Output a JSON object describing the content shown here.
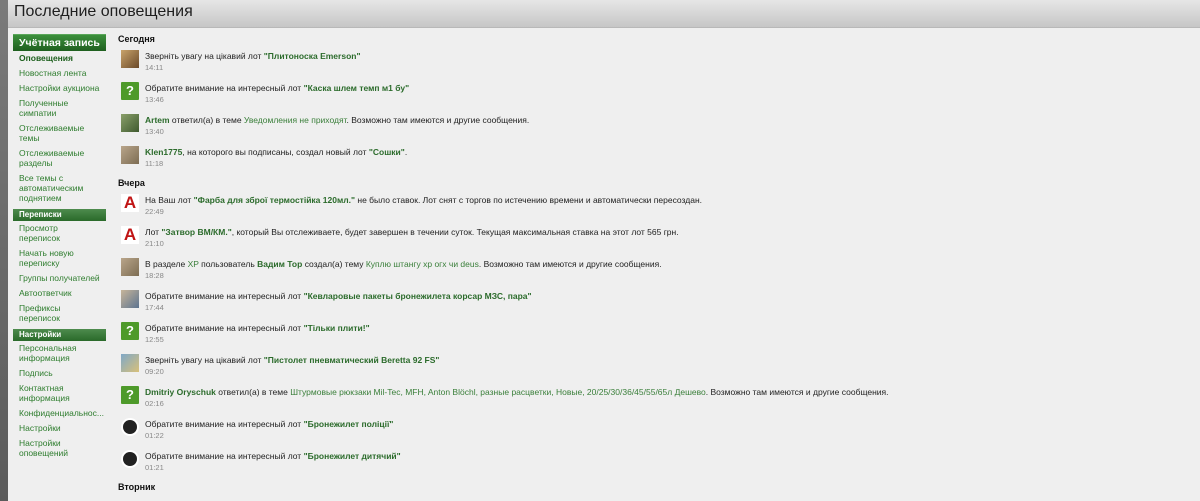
{
  "page": {
    "title": "Последние оповещения"
  },
  "sidebar": {
    "account_title": "Учётная запись",
    "account_items": [
      {
        "label": "Оповещения"
      },
      {
        "label": "Новостная лента"
      },
      {
        "label": "Настройки аукциона"
      },
      {
        "label": "Полученные симпатии"
      },
      {
        "label": "Отслеживаемые темы"
      },
      {
        "label": "Отслеживаемые разделы"
      },
      {
        "label": "Все темы с автоматическим поднятием"
      }
    ],
    "conversations_title": "Переписки",
    "conversations_items": [
      {
        "label": "Просмотр переписок"
      },
      {
        "label": "Начать новую переписку"
      },
      {
        "label": "Группы получателей"
      },
      {
        "label": "Автоответчик"
      },
      {
        "label": "Префиксы переписок"
      }
    ],
    "settings_title": "Настройки",
    "settings_items": [
      {
        "label": "Персональная информация"
      },
      {
        "label": "Подпись"
      },
      {
        "label": "Контактная информация"
      },
      {
        "label": "Конфиденциальнос..."
      },
      {
        "label": "Настройки"
      },
      {
        "label": "Настройки оповещений"
      }
    ]
  },
  "days": {
    "today": "Сегодня",
    "yesterday": "Вчера",
    "tuesday": "Вторник"
  },
  "alerts": [
    {
      "p1": "Зверніть увагу на цікавий лот ",
      "lot": "\"Плитоноска Emerson\"",
      "time": "14:11"
    },
    {
      "p1": "Обратите внимание на интересный лот ",
      "lot": "\"Каска шлем темп м1 бу\"",
      "time": "13:46"
    },
    {
      "user": "Artem",
      "p1": " ответил(а) в теме ",
      "link": "Уведомления не приходят",
      "p2": ". Возможно там имеются и другие сообщения.",
      "time": "13:40"
    },
    {
      "user": "Klen1775",
      "p1": ", на которого вы подписаны, создал новый лот ",
      "lot": "\"Сошки\"",
      "p2": ".",
      "time": "11:18"
    },
    {
      "p1": "На Ваш лот ",
      "lot": "\"Фарба для зброї термостійка 120мл.\"",
      "p2": " не было ставок. Лот снят с торгов по истечению времени и автоматически пересоздан.",
      "time": "22:49"
    },
    {
      "p1": "Лот ",
      "lot": "\"Затвор ВМ/КМ.\"",
      "p2": ", который Вы отслеживаете, будет завершен в течении суток. Текущая максимальная ставка на этот лот 565 грн.",
      "time": "21:10"
    },
    {
      "p1": "В разделе ",
      "link0": "XP",
      "p1b": " пользователь ",
      "user": "Вадим Тор",
      "p1c": " создал(а) тему ",
      "link": "Куплю штангу хр огх чи deus",
      "p2": ". Возможно там имеются и другие сообщения.",
      "time": "18:28"
    },
    {
      "p1": "Обратите внимание на интересный лот ",
      "lot": "\"Кевларовые пакеты бронежилета корсар МЗС, пара\"",
      "time": "17:44"
    },
    {
      "p1": "Обратите внимание на интересный лот ",
      "lot": "\"Тільки плити!\"",
      "time": "12:55"
    },
    {
      "p1": "Зверніть увагу на цікавий лот ",
      "lot": "\"Пистолет пневматический Beretta 92 FS\"",
      "time": "09:20"
    },
    {
      "user": "Dmitriy Oryschuk",
      "p1": " ответил(а) в теме ",
      "link": "Штурмовые рюкзаки Mil-Tec, MFH, Anton Blöchl, разные расцветки, Новые, 20/25/30/36/45/55/65л Дешево",
      "p2": ". Возможно там имеются и другие сообщения.",
      "time": "02:16"
    },
    {
      "p1": "Обратите внимание на интересный лот ",
      "lot": "\"Бронежилет поліції\"",
      "time": "01:22"
    },
    {
      "p1": "Обратите внимание на интересный лот ",
      "lot": "\"Бронежилет дитячий\"",
      "time": "01:21"
    }
  ]
}
